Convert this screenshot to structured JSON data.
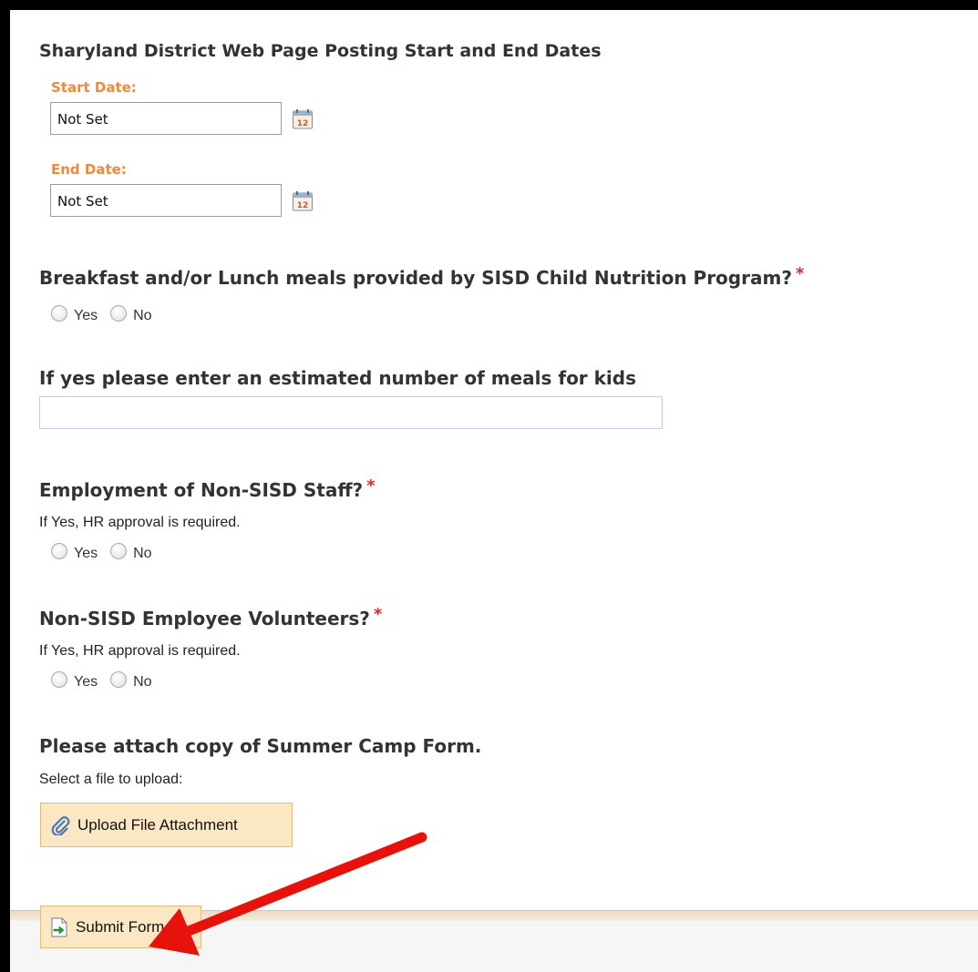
{
  "posting": {
    "title": "Sharyland District Web Page Posting Start and End Dates",
    "start_label": "Start Date:",
    "start_value": "Not Set",
    "end_label": "End Date:",
    "end_value": "Not Set"
  },
  "meals_question": {
    "title": "Breakfast and/or Lunch meals provided by SISD Child Nutrition Program?",
    "required_mark": "*",
    "options": [
      "Yes",
      "No"
    ]
  },
  "meals_count": {
    "title": "If yes please enter an estimated number of meals for kids",
    "value": ""
  },
  "employment": {
    "title": "Employment of Non-SISD Staff?",
    "required_mark": "*",
    "helper": "If Yes, HR approval is required.",
    "options": [
      "Yes",
      "No"
    ]
  },
  "volunteers": {
    "title": "Non-SISD Employee Volunteers?",
    "required_mark": "*",
    "helper": "If Yes, HR approval is required.",
    "options": [
      "Yes",
      "No"
    ]
  },
  "attachment": {
    "title": "Please attach copy of Summer Camp Form.",
    "helper": "Select a file to upload:",
    "upload_label": "Upload File Attachment"
  },
  "submit": {
    "label": "Submit Form"
  },
  "icons": {
    "calendar": "calendar-icon",
    "paperclip": "paperclip-icon",
    "submit": "submit-form-icon"
  },
  "colors": {
    "date_label": "#f0883e",
    "required": "#d42a2a",
    "button_bg": "#fbe7c4",
    "button_border": "#e8b980",
    "arrow": "#e8120c"
  }
}
